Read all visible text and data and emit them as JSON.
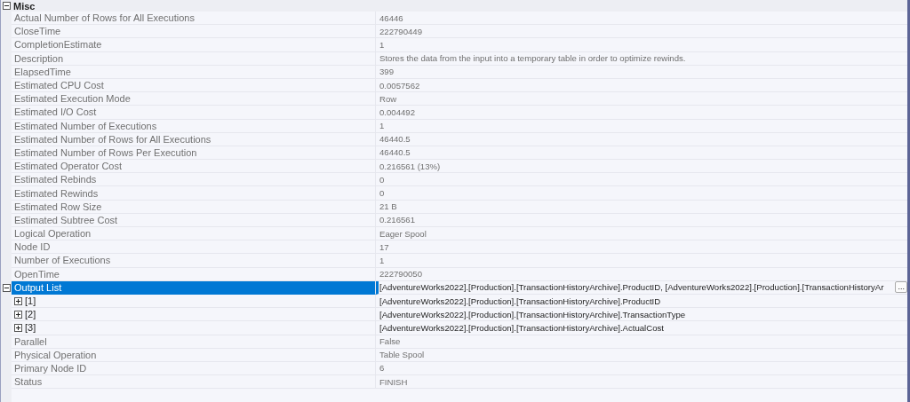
{
  "category": {
    "name": "Misc",
    "expanded": true
  },
  "properties": [
    {
      "name": "Actual Number of Rows for All Executions",
      "value": "46446",
      "selected": false
    },
    {
      "name": "CloseTime",
      "value": "222790449",
      "selected": false
    },
    {
      "name": "CompletionEstimate",
      "value": "1",
      "selected": false
    },
    {
      "name": "Description",
      "value": "Stores the data from the input into a temporary table in order to optimize rewinds.",
      "selected": false
    },
    {
      "name": "ElapsedTime",
      "value": "399",
      "selected": false
    },
    {
      "name": "Estimated CPU Cost",
      "value": "0.0057562",
      "selected": false
    },
    {
      "name": "Estimated Execution Mode",
      "value": "Row",
      "selected": false
    },
    {
      "name": "Estimated I/O Cost",
      "value": "0.004492",
      "selected": false
    },
    {
      "name": "Estimated Number of Executions",
      "value": "1",
      "selected": false
    },
    {
      "name": "Estimated Number of Rows for All Executions",
      "value": "46440.5",
      "selected": false
    },
    {
      "name": "Estimated Number of Rows Per Execution",
      "value": "46440.5",
      "selected": false
    },
    {
      "name": "Estimated Operator Cost",
      "value": "0.216561 (13%)",
      "selected": false
    },
    {
      "name": "Estimated Rebinds",
      "value": "0",
      "selected": false
    },
    {
      "name": "Estimated Rewinds",
      "value": "0",
      "selected": false
    },
    {
      "name": "Estimated Row Size",
      "value": "21 B",
      "selected": false
    },
    {
      "name": "Estimated Subtree Cost",
      "value": "0.216561",
      "selected": false
    },
    {
      "name": "Logical Operation",
      "value": "Eager Spool",
      "selected": false
    },
    {
      "name": "Node ID",
      "value": "17",
      "selected": false
    },
    {
      "name": "Number of Executions",
      "value": "1",
      "selected": false
    },
    {
      "name": "OpenTime",
      "value": "222790050",
      "selected": false
    },
    {
      "name": "Output List",
      "value": "[AdventureWorks2022].[Production].[TransactionHistoryArchive].ProductID, [AdventureWorks2022].[Production].[TransactionHistoryAr",
      "selected": true,
      "expanded": true,
      "ellipsis": "...",
      "children": [
        {
          "name": "[1]",
          "value": "[AdventureWorks2022].[Production].[TransactionHistoryArchive].ProductID",
          "selected": false,
          "expanded": false
        },
        {
          "name": "[2]",
          "value": "[AdventureWorks2022].[Production].[TransactionHistoryArchive].TransactionType",
          "selected": false,
          "expanded": false
        },
        {
          "name": "[3]",
          "value": "[AdventureWorks2022].[Production].[TransactionHistoryArchive].ActualCost",
          "selected": false,
          "expanded": false
        }
      ]
    },
    {
      "name": "Parallel",
      "value": "False",
      "selected": false
    },
    {
      "name": "Physical Operation",
      "value": "Table Spool",
      "selected": false
    },
    {
      "name": "Primary Node ID",
      "value": "6",
      "selected": false
    },
    {
      "name": "Status",
      "value": "FINISH",
      "selected": false
    }
  ]
}
